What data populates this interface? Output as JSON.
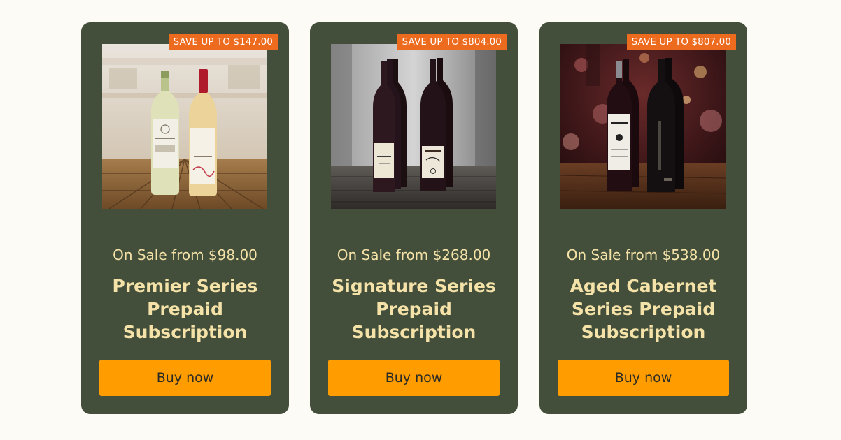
{
  "cards": [
    {
      "badge": "SAVE UP TO $147.00",
      "price": "On Sale from $98.00",
      "title": "Premier Series Prepaid Subscription",
      "button_label": "Buy now",
      "image": "wine-bottles-white"
    },
    {
      "badge": "SAVE UP TO $804.00",
      "price": "On Sale from $268.00",
      "title": "Signature Series Prepaid Subscription",
      "button_label": "Buy now",
      "image": "wine-bottles-red"
    },
    {
      "badge": "SAVE UP TO $807.00",
      "price": "On Sale from $538.00",
      "title": "Aged Cabernet Series Prepaid Subscription",
      "button_label": "Buy now",
      "image": "wine-bottles-cabernet"
    }
  ],
  "colors": {
    "page_background": "#fdfbf6",
    "card_background": "#434f3a",
    "badge_background": "#ed6b1f",
    "text_accent": "#f5e2a8",
    "button_background": "#ff9d00"
  }
}
